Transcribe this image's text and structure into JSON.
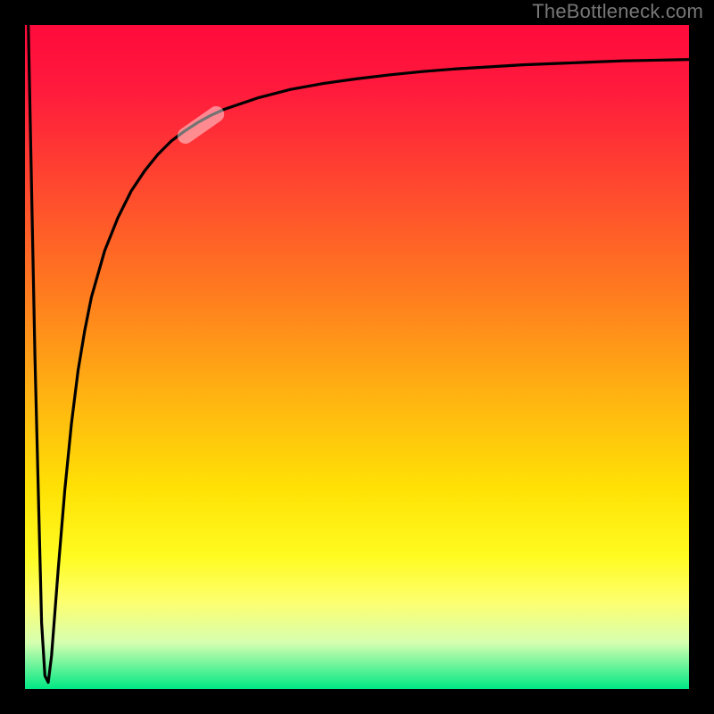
{
  "attribution": "TheBottleneck.com",
  "colors": {
    "frame": "#000000",
    "gradient_top": "#ff0a3c",
    "gradient_bottom": "#00e884",
    "curve": "#000000",
    "highlight": "rgba(255,255,255,0.45)"
  },
  "chart_data": {
    "type": "line",
    "title": "",
    "xlabel": "",
    "ylabel": "",
    "xlim": [
      0,
      100
    ],
    "ylim": [
      0,
      100
    ],
    "series": [
      {
        "name": "bottleneck-curve",
        "x": [
          0.5,
          1.5,
          2.5,
          3.0,
          3.5,
          4.0,
          5.0,
          6.0,
          7.0,
          8.0,
          9.0,
          10.0,
          12.0,
          14.0,
          16.0,
          18.0,
          20.0,
          22.0,
          24.0,
          26.0,
          28.0,
          30.0,
          35.0,
          40.0,
          45.0,
          50.0,
          55.0,
          60.0,
          65.0,
          70.0,
          75.0,
          80.0,
          85.0,
          90.0,
          95.0,
          100.0
        ],
        "y": [
          100.0,
          50.0,
          10.0,
          2.0,
          1.0,
          5.0,
          18.0,
          30.0,
          40.0,
          48.0,
          54.0,
          59.0,
          66.0,
          71.0,
          75.0,
          78.0,
          80.5,
          82.5,
          84.0,
          85.3,
          86.4,
          87.3,
          89.0,
          90.3,
          91.2,
          91.9,
          92.5,
          93.0,
          93.4,
          93.7,
          94.0,
          94.2,
          94.4,
          94.6,
          94.7,
          94.8
        ]
      }
    ],
    "highlight_segment": {
      "x_range": [
        23.0,
        30.0
      ],
      "approx_value": 85.0,
      "angle_deg": -35
    }
  }
}
